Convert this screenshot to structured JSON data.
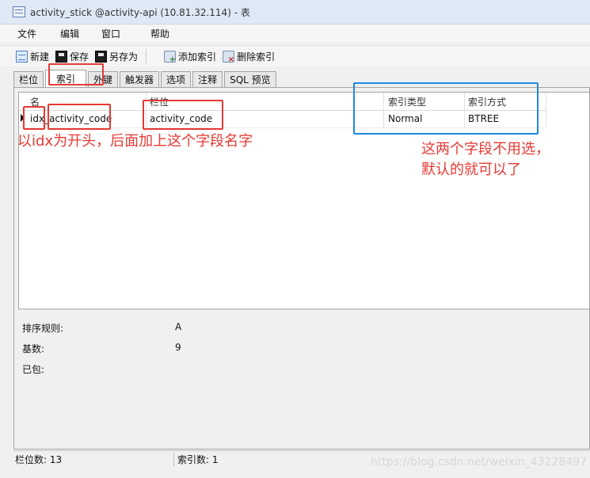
{
  "window": {
    "title": "activity_stick @activity-api (10.81.32.114) - 表"
  },
  "menu": {
    "items": [
      "文件",
      "编辑",
      "窗口",
      "帮助"
    ]
  },
  "toolbar": {
    "new_label": "新建",
    "save_label": "保存",
    "saveas_label": "另存为",
    "add_index_label": "添加索引",
    "delete_index_label": "删除索引"
  },
  "tabs": [
    "栏位",
    "索引",
    "外键",
    "触发器",
    "选项",
    "注释",
    "SQL 预览"
  ],
  "grid": {
    "headers": {
      "name": "名",
      "field": "栏位",
      "index_type": "索引类型",
      "index_method": "索引方式"
    },
    "rows": [
      {
        "name": "idx_activity_code",
        "field": "activity_code",
        "index_type": "Normal",
        "index_method": "BTREE"
      }
    ]
  },
  "properties": {
    "collation_label": "排序规则:",
    "collation_value": "A",
    "cardinality_label": "基数:",
    "cardinality_value": "9",
    "packed_label": "已包:"
  },
  "status": {
    "field_count": "栏位数: 13",
    "index_count": "索引数: 1"
  },
  "annotations": {
    "left_note": "以idx为开头，后面加上这个字段名字",
    "right_note_line1": "这两个字段不用选，",
    "right_note_line2": "默认的就可以了",
    "watermark": "https://blog.csdn.net/weixin_43228497"
  },
  "colors": {
    "annotation_red": "#e53935",
    "annotation_blue": "#1e88e5"
  }
}
